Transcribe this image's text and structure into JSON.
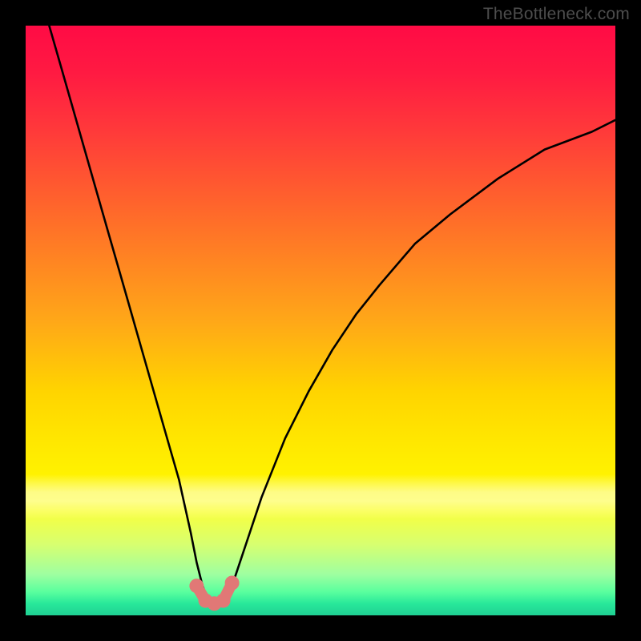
{
  "attribution": "TheBottleneck.com",
  "colors": {
    "frame": "#000000",
    "curve_stroke": "#000000",
    "marker_fill": "#e17876",
    "gradient_stops": [
      "#ff0b45",
      "#ff1a42",
      "#ff3a3a",
      "#ff6a2a",
      "#ffa718",
      "#ffd400",
      "#ffe600",
      "#fff200",
      "#fbff3a",
      "#d7ff70",
      "#9fffa0",
      "#5aff9e",
      "#28e89a",
      "#1fd093"
    ]
  },
  "chart_data": {
    "type": "line",
    "title": "",
    "xlabel": "",
    "ylabel": "",
    "xlim": [
      0,
      100
    ],
    "ylim": [
      0,
      100
    ],
    "note": "Axes are unlabeled in the original image; x and y are normalized 0–100 from left→right and bottom→top of the plot area. Curve is a V-shaped bottleneck curve with its minimum near x≈32.",
    "series": [
      {
        "name": "bottleneck-curve",
        "x": [
          4,
          6,
          8,
          10,
          12,
          14,
          16,
          18,
          20,
          22,
          24,
          26,
          28,
          29,
          30,
          31,
          32,
          33,
          34,
          35,
          36,
          38,
          40,
          44,
          48,
          52,
          56,
          60,
          66,
          72,
          80,
          88,
          96,
          100
        ],
        "y": [
          100,
          93,
          86,
          79,
          72,
          65,
          58,
          51,
          44,
          37,
          30,
          23,
          14,
          9,
          5,
          2.5,
          2,
          2.2,
          3,
          5,
          8,
          14,
          20,
          30,
          38,
          45,
          51,
          56,
          63,
          68,
          74,
          79,
          82,
          84
        ]
      }
    ],
    "markers": [
      {
        "name": "trough-marker-1",
        "x": 29.0,
        "y": 5.0
      },
      {
        "name": "trough-marker-2",
        "x": 30.5,
        "y": 2.5
      },
      {
        "name": "trough-marker-3",
        "x": 32.0,
        "y": 2.0
      },
      {
        "name": "trough-marker-4",
        "x": 33.5,
        "y": 2.5
      },
      {
        "name": "trough-marker-5",
        "x": 35.0,
        "y": 5.5
      }
    ],
    "background_scale": {
      "description": "Vertical color scale from red (high bottleneck) at top to green (no bottleneck) at bottom, with a pale-yellow highlight band around y≈18–26.",
      "stops_pct_from_top": [
        0,
        8,
        18,
        32,
        50,
        62,
        70,
        76,
        82,
        88,
        93,
        96,
        98,
        100
      ]
    }
  }
}
